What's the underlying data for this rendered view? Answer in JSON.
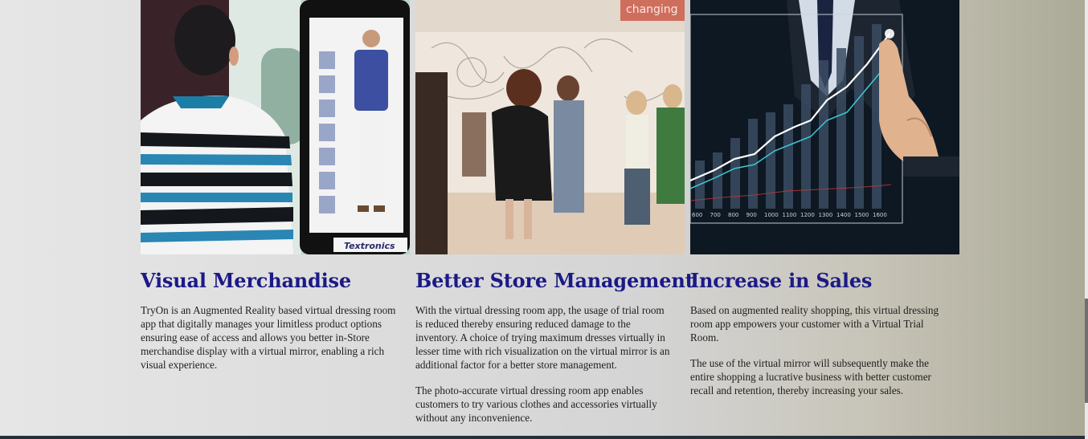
{
  "features": [
    {
      "title": "Visual Merchandise",
      "image_caption": "Textronics",
      "paragraphs": [
        "TryOn is an Augmented Reality based virtual dressing room app that digitally manages your limitless product options ensuring ease of access and allows you better in-Store merchandise display with a virtual mirror, enabling a rich visual experience."
      ]
    },
    {
      "title": "Better Store Management",
      "image_caption": "changing",
      "paragraphs": [
        "With the virtual dressing room app, the usage of trial room is reduced thereby ensuring reduced damage to the inventory. A choice of trying maximum dresses virtually in lesser time with rich visualization on the virtual mirror is an additional factor for a better store management.",
        "The photo-accurate virtual dressing room app enables customers to try various clothes and accessories virtually without any inconvenience."
      ]
    },
    {
      "title": "Increase in Sales",
      "image_caption": "",
      "axis_labels": [
        "600",
        "700",
        "800",
        "900",
        "1000",
        "1100",
        "1200",
        "1300",
        "1400",
        "1500",
        "1600"
      ],
      "paragraphs": [
        "Based on augmented reality shopping, this virtual dressing room app empowers your customer with a Virtual Trial Room.",
        "The use of the virtual mirror will subsequently make the entire shopping a lucrative business with better customer recall and retention, thereby increasing your sales."
      ]
    }
  ],
  "colors": {
    "heading": "#1c1a86",
    "body_text": "#1e1e1e",
    "footer_bar": "#23313a"
  }
}
